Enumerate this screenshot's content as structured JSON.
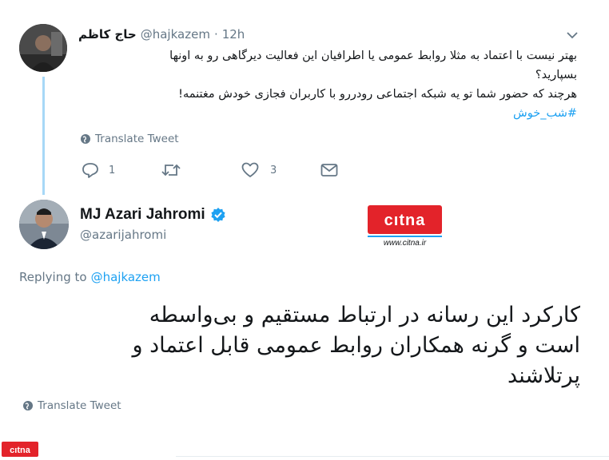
{
  "parent_tweet": {
    "author_name": "حاج کاظم",
    "handle": "@hajkazem",
    "separator": "·",
    "time": "12h",
    "text_line1": "بهتر نیست با اعتماد به مثلا روابط عمومی یا اطرافیان این فعالیت دیرگاهی رو به اونها",
    "text_line2": "بسپارید؟",
    "text_line3": "هرچند که حضور شما تو یه شبکه اجتماعی رودررو با کاربران فجازی خودش مغتنمه!",
    "hashtag": "#شب_خوش",
    "translate_label": "Translate Tweet",
    "reply_count": "1",
    "like_count": "3"
  },
  "main_tweet": {
    "author_name": "MJ Azari Jahromi",
    "handle": "@azarijahromi",
    "replying_prefix": "Replying to",
    "replying_handle": "@hajkazem",
    "text_line1": "کارکرد این رسانه در ارتباط مستقیم و بی‌واسطه",
    "text_line2": "است و گرنه همکاران روابط عمومی قابل اعتماد و",
    "text_line3": "پرتلاشند",
    "translate_label": "Translate Tweet"
  },
  "watermark": {
    "logo_text": "CiTNa",
    "url_text": "www.citna.ir",
    "corner_text": "CiTNa"
  },
  "colors": {
    "accent": "#1da1f2",
    "thread_line": "#a7d8f7",
    "muted": "#657786",
    "citna_red": "#e3232a"
  }
}
